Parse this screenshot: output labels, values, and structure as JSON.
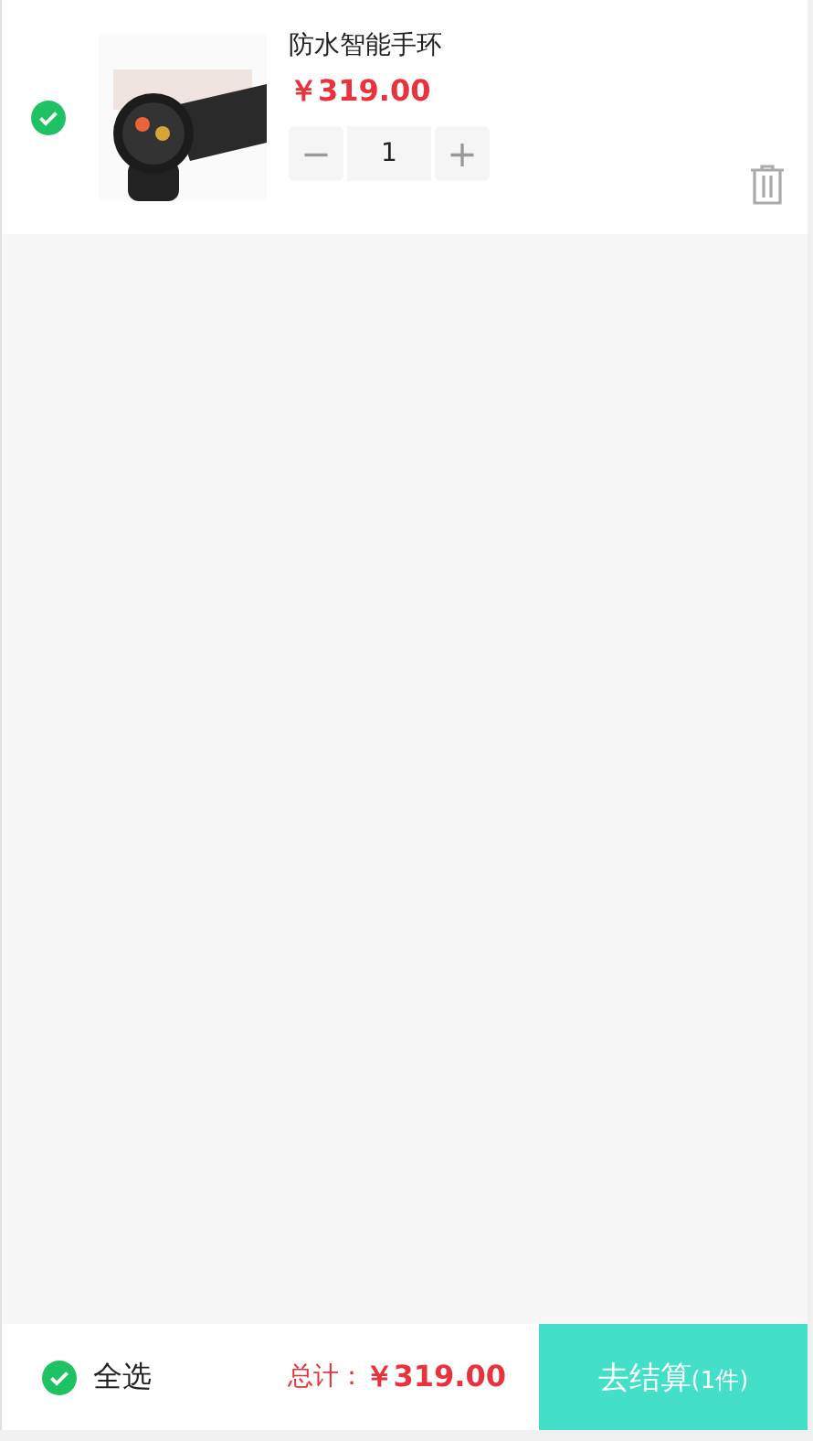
{
  "cart_items": [
    {
      "checked": true,
      "name": "防水智能手环",
      "price": "￥319.00",
      "quantity": "1",
      "minus": "−",
      "plus": "+"
    }
  ],
  "footer": {
    "select_all": {
      "checked": true,
      "label": "全选"
    },
    "total_label": "总计：",
    "total": "￥319.00",
    "checkout": {
      "label": "去结算",
      "count": "(1件)"
    }
  }
}
